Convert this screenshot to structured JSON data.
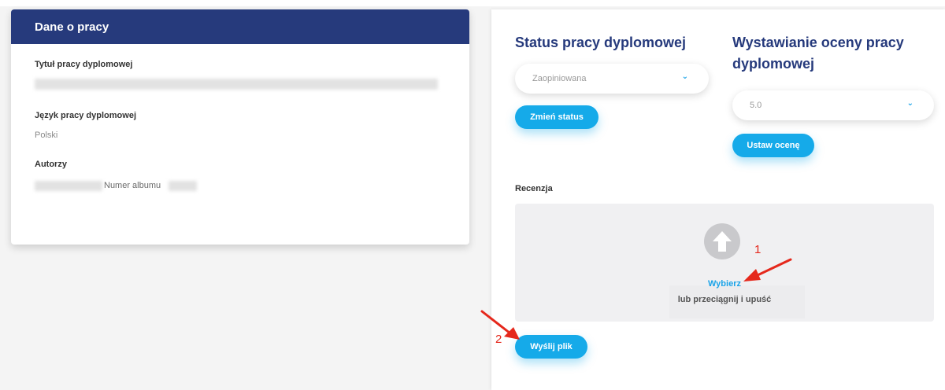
{
  "work_card": {
    "title": "Dane o pracy",
    "thesis_title_label": "Tytuł pracy dyplomowej",
    "language_label": "Język pracy dyplomowej",
    "language_value": "Polski",
    "authors_label": "Autorzy",
    "album_label": "Numer albumu"
  },
  "status": {
    "title": "Status pracy dyplomowej",
    "select_value": "Zaopiniowana",
    "button_label": "Zmień status"
  },
  "grade": {
    "title_line1": "Wystawianie oceny pracy",
    "title_line2": "dyplomowej",
    "select_value": "5.0",
    "button_label": "Ustaw ocenę"
  },
  "review": {
    "label": "Recenzja",
    "choose_label": "Wybierz",
    "drag_label": "lub przeciągnij i upuść",
    "send_button_label": "Wyślij plik"
  },
  "annotations": {
    "marker_1": "1",
    "marker_2": "2",
    "arrow_color": "#e5281c"
  },
  "colors": {
    "header_bg": "#263a7c",
    "accent": "#15aae9"
  }
}
